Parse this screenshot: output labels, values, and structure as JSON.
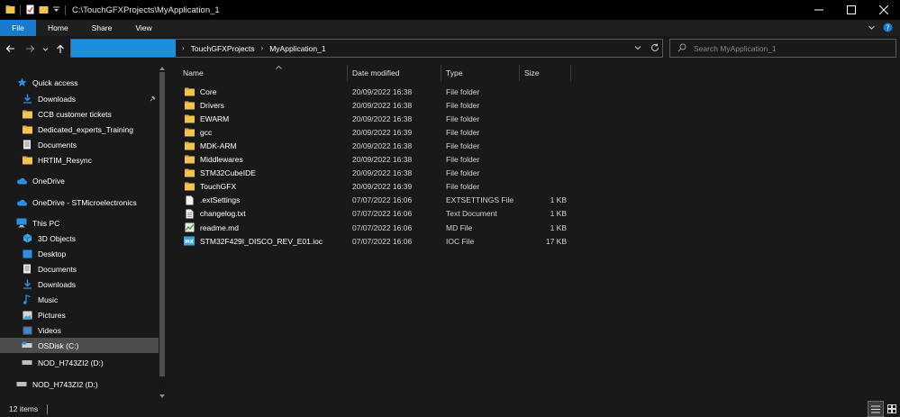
{
  "window": {
    "title": "C:\\TouchGFXProjects\\MyApplication_1",
    "controls": [
      "minimize",
      "maximize",
      "close"
    ]
  },
  "ribbon": {
    "tabs": [
      "File",
      "Home",
      "Share",
      "View"
    ]
  },
  "address": {
    "crumbs": [
      "TouchGFXProjects",
      "MyApplication_1"
    ]
  },
  "search": {
    "placeholder": "Search MyApplication_1"
  },
  "nav": {
    "quick_access": "Quick access",
    "pinned": [
      "Downloads",
      "CCB customer tickets",
      "Dedicated_experts_Training",
      "Documents",
      "HRTIM_Resync"
    ],
    "onedrive": "OneDrive",
    "onedrive_st": "OneDrive - STMicroelectronics",
    "this_pc": "This PC",
    "pc_items": [
      "3D Objects",
      "Desktop",
      "Documents",
      "Downloads",
      "Music",
      "Pictures",
      "Videos",
      "OSDisk (C:)",
      "NOD_H743ZI2 (D:)"
    ],
    "drive": "NOD_H743ZI2 (D:)"
  },
  "columns": [
    "Name",
    "Date modified",
    "Type",
    "Size"
  ],
  "files": [
    {
      "name": "Core",
      "date": "20/09/2022 16:38",
      "type": "File folder",
      "size": "",
      "icon": "folder-icon"
    },
    {
      "name": "Drivers",
      "date": "20/09/2022 16:38",
      "type": "File folder",
      "size": "",
      "icon": "folder-icon"
    },
    {
      "name": "EWARM",
      "date": "20/09/2022 16:38",
      "type": "File folder",
      "size": "",
      "icon": "folder-icon"
    },
    {
      "name": "gcc",
      "date": "20/09/2022 16:39",
      "type": "File folder",
      "size": "",
      "icon": "folder-icon"
    },
    {
      "name": "MDK-ARM",
      "date": "20/09/2022 16:38",
      "type": "File folder",
      "size": "",
      "icon": "folder-icon"
    },
    {
      "name": "Middlewares",
      "date": "20/09/2022 16:38",
      "type": "File folder",
      "size": "",
      "icon": "folder-icon"
    },
    {
      "name": "STM32CubeIDE",
      "date": "20/09/2022 16:38",
      "type": "File folder",
      "size": "",
      "icon": "folder-icon"
    },
    {
      "name": "TouchGFX",
      "date": "20/09/2022 16:39",
      "type": "File folder",
      "size": "",
      "icon": "folder-icon"
    },
    {
      "name": ".extSettings",
      "date": "07/07/2022 16:06",
      "type": "EXTSETTINGS File",
      "size": "1 KB",
      "icon": "file-icon"
    },
    {
      "name": "changelog.txt",
      "date": "07/07/2022 16:06",
      "type": "Text Document",
      "size": "1 KB",
      "icon": "text-file-icon"
    },
    {
      "name": "readme.md",
      "date": "07/07/2022 16:06",
      "type": "MD File",
      "size": "1 KB",
      "icon": "md-file-icon"
    },
    {
      "name": "STM32F429I_DISCO_REV_E01.ioc",
      "date": "07/07/2022 16:06",
      "type": "IOC File",
      "size": "17 KB",
      "icon": "ioc-file-icon"
    }
  ],
  "status": {
    "item_count": "12 items"
  },
  "colors": {
    "accent": "#1979ca",
    "address_highlight": "#1c8fdc",
    "folder": "#f0c44e",
    "background": "#191919"
  }
}
